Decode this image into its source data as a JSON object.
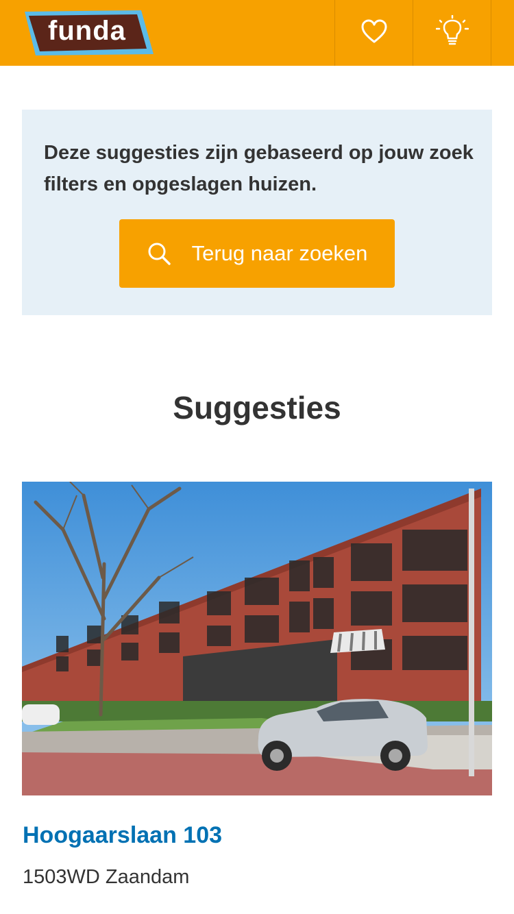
{
  "header": {
    "logo_text": "funda",
    "favorites_icon": "heart-icon",
    "tips_icon": "lightbulb-icon",
    "background_color": "#f7a100"
  },
  "info_panel": {
    "text": "Deze suggesties zijn gebaseerd op jouw zoek filters en opgeslagen huizen.",
    "button_label": "Terug naar zoeken",
    "button_icon": "search-icon",
    "background_color": "#e6f0f7"
  },
  "suggestions": {
    "title": "Suggesties",
    "listings": [
      {
        "address": "Hoogaarslaan 103",
        "city": "1503WD Zaandam",
        "address_color": "#0071b3"
      }
    ]
  }
}
